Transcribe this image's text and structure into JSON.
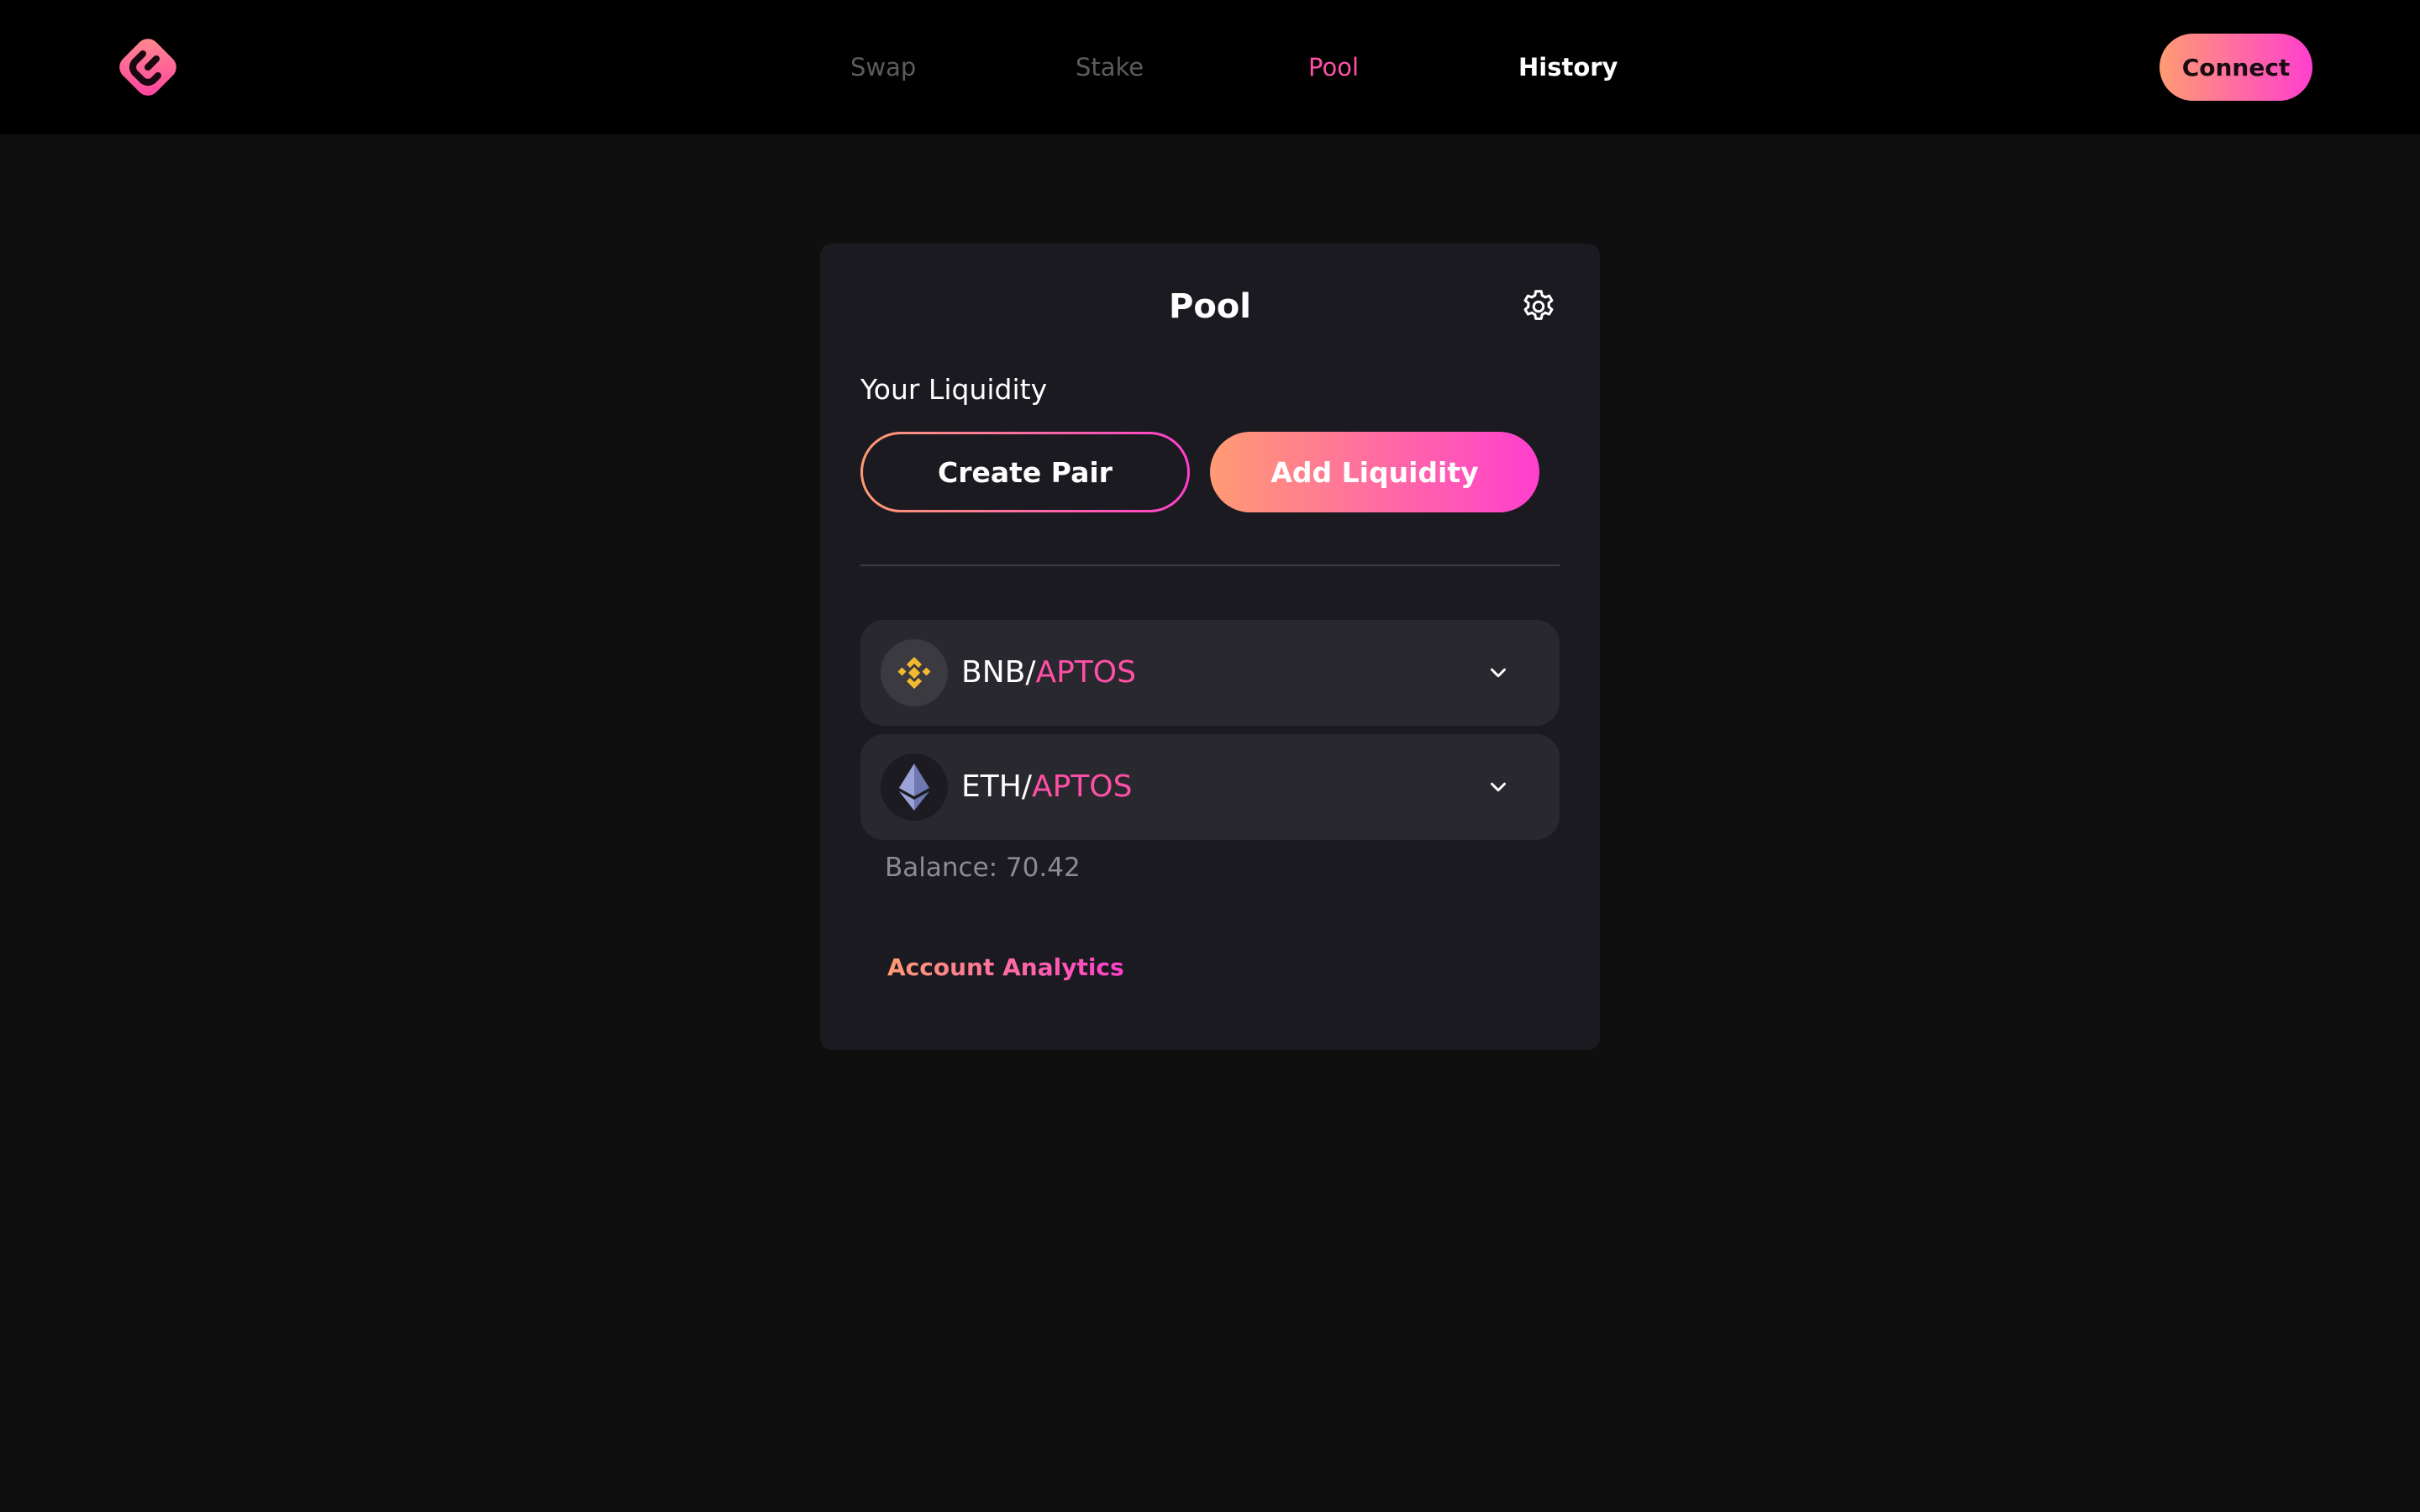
{
  "header": {
    "logo_icon": "brand-logo-icon",
    "nav": [
      {
        "label": "Swap",
        "state": "inactive"
      },
      {
        "label": "Stake",
        "state": "inactive"
      },
      {
        "label": "Pool",
        "state": "active"
      },
      {
        "label": "History",
        "state": "highlighted"
      }
    ],
    "connect_label": "Connect"
  },
  "pool_card": {
    "title": "Pool",
    "settings_icon": "gear-icon",
    "section_label": "Your Liquidity",
    "create_pair_label": "Create Pair",
    "add_liquidity_label": "Add Liquidity",
    "pairs": [
      {
        "base": "BNB",
        "separator": "/",
        "quote": "APTOS",
        "icon": "bnb-token-icon",
        "expand_icon": "chevron-down-icon"
      },
      {
        "base": "ETH",
        "separator": "/",
        "quote": "APTOS",
        "icon": "eth-token-icon",
        "expand_icon": "chevron-down-icon"
      }
    ],
    "balance_text": "Balance: 70.42",
    "analytics_link": "Account Analytics"
  },
  "colors": {
    "accent_pink": "#ff4fa6",
    "gradient_start": "#ff9b73",
    "gradient_end": "#ff3fce",
    "background": "#0f0f0f",
    "card_background": "#1b1a20",
    "topbar_background": "#000000",
    "bnb_yellow": "#f3ba2f",
    "eth_purple": "#8a92c8"
  }
}
